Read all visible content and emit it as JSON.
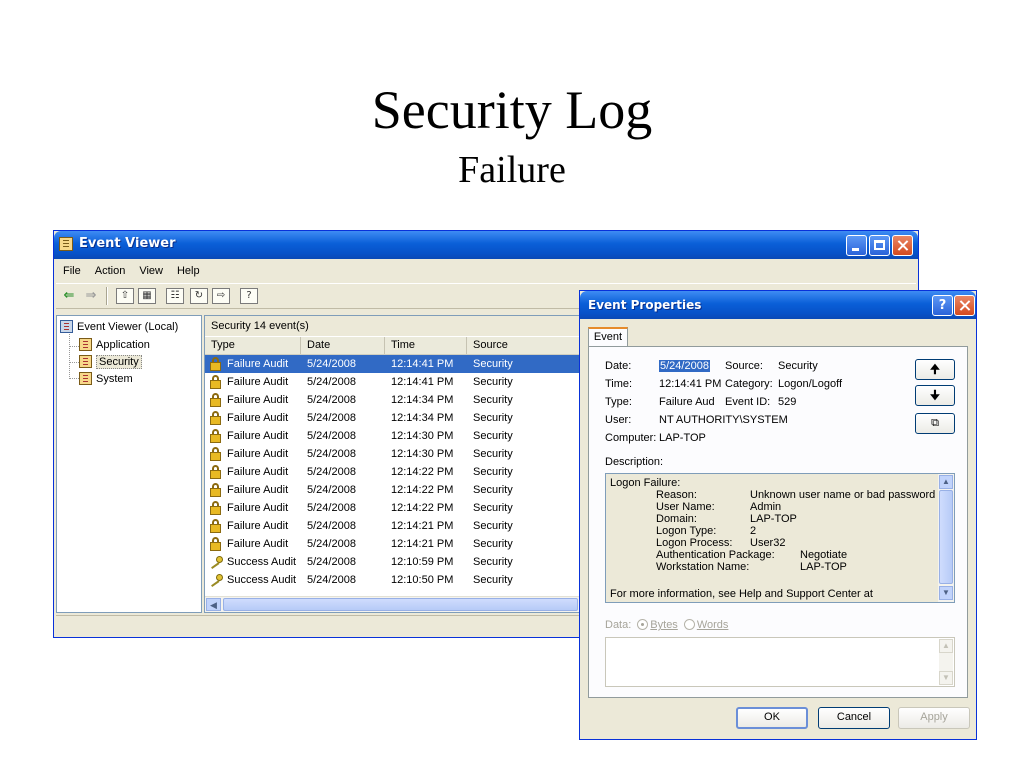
{
  "slide": {
    "title": "Security Log",
    "subtitle": "Failure"
  },
  "event_viewer": {
    "title": "Event Viewer",
    "menu": [
      "File",
      "Action",
      "View",
      "Help"
    ],
    "tree": {
      "root": "Event Viewer (Local)",
      "children": [
        "Application",
        "Security",
        "System"
      ],
      "selected": "Security"
    },
    "list_caption": "Security   14 event(s)",
    "columns": [
      "Type",
      "Date",
      "Time",
      "Source"
    ],
    "rows": [
      {
        "type": "Failure Audit",
        "date": "5/24/2008",
        "time": "12:14:41 PM",
        "source": "Security",
        "icon": "lock-icon",
        "selected": true
      },
      {
        "type": "Failure Audit",
        "date": "5/24/2008",
        "time": "12:14:41 PM",
        "source": "Security",
        "icon": "lock-icon"
      },
      {
        "type": "Failure Audit",
        "date": "5/24/2008",
        "time": "12:14:34 PM",
        "source": "Security",
        "icon": "lock-icon"
      },
      {
        "type": "Failure Audit",
        "date": "5/24/2008",
        "time": "12:14:34 PM",
        "source": "Security",
        "icon": "lock-icon"
      },
      {
        "type": "Failure Audit",
        "date": "5/24/2008",
        "time": "12:14:30 PM",
        "source": "Security",
        "icon": "lock-icon"
      },
      {
        "type": "Failure Audit",
        "date": "5/24/2008",
        "time": "12:14:30 PM",
        "source": "Security",
        "icon": "lock-icon"
      },
      {
        "type": "Failure Audit",
        "date": "5/24/2008",
        "time": "12:14:22 PM",
        "source": "Security",
        "icon": "lock-icon"
      },
      {
        "type": "Failure Audit",
        "date": "5/24/2008",
        "time": "12:14:22 PM",
        "source": "Security",
        "icon": "lock-icon"
      },
      {
        "type": "Failure Audit",
        "date": "5/24/2008",
        "time": "12:14:22 PM",
        "source": "Security",
        "icon": "lock-icon"
      },
      {
        "type": "Failure Audit",
        "date": "5/24/2008",
        "time": "12:14:21 PM",
        "source": "Security",
        "icon": "lock-icon"
      },
      {
        "type": "Failure Audit",
        "date": "5/24/2008",
        "time": "12:14:21 PM",
        "source": "Security",
        "icon": "lock-icon"
      },
      {
        "type": "Success Audit",
        "date": "5/24/2008",
        "time": "12:10:59 PM",
        "source": "Security",
        "icon": "key-icon"
      },
      {
        "type": "Success Audit",
        "date": "5/24/2008",
        "time": "12:10:50 PM",
        "source": "Security",
        "icon": "key-icon"
      }
    ]
  },
  "event_properties": {
    "title": "Event Properties",
    "help_glyph": "?",
    "tab": "Event",
    "labels": {
      "date": "Date:",
      "source": "Source:",
      "time": "Time:",
      "category": "Category:",
      "type": "Type:",
      "event_id": "Event ID:",
      "user": "User:",
      "computer": "Computer:",
      "description": "Description:"
    },
    "values": {
      "date": "5/24/2008",
      "source": "Security",
      "time": "12:14:41 PM",
      "category": "Logon/Logoff",
      "type": "Failure Aud",
      "event_id": "529",
      "user": "NT AUTHORITY\\SYSTEM",
      "computer": "LAP-TOP"
    },
    "description": {
      "heading": "Logon Failure:",
      "fields": [
        {
          "label": "Reason:",
          "value": "Unknown user name or bad password"
        },
        {
          "label": "User Name:",
          "value": "Admin"
        },
        {
          "label": "Domain:",
          "value": "LAP-TOP"
        },
        {
          "label": "Logon Type:",
          "value": "2"
        },
        {
          "label": "Logon Process:",
          "value": "User32"
        },
        {
          "label": "Authentication Package:",
          "value": "Negotiate"
        },
        {
          "label": "Workstation Name:",
          "value": "LAP-TOP"
        }
      ],
      "footer": "For more information, see Help and Support Center at"
    },
    "data": {
      "label": "Data:",
      "bytes": "Bytes",
      "words": "Words"
    },
    "buttons": {
      "ok": "OK",
      "cancel": "Cancel",
      "apply": "Apply"
    }
  }
}
